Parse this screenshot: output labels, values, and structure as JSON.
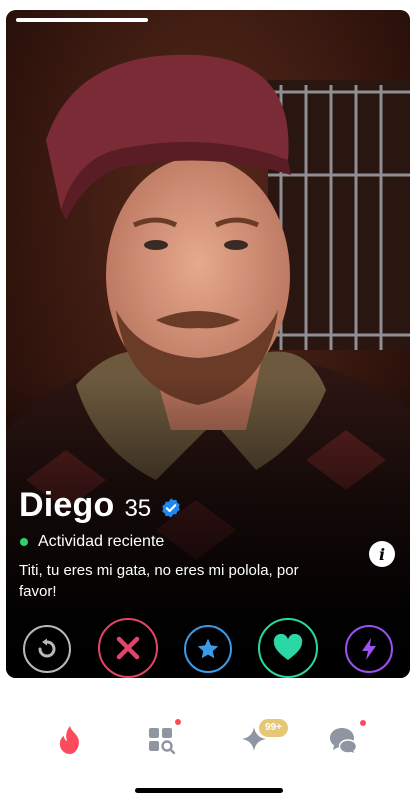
{
  "profile": {
    "name": "Diego",
    "age": "35",
    "verified": true,
    "activity": "Actividad reciente",
    "bio": "Titi, tu eres mi gata, no eres mi polola, por favor!"
  },
  "photo": {
    "index": 1,
    "progress_fraction": 0.33
  },
  "actions": [
    {
      "name": "rewind",
      "icon": "rewind-icon",
      "color": "#b8b9bd"
    },
    {
      "name": "nope",
      "icon": "x-icon",
      "color": "#e2456a"
    },
    {
      "name": "super-like",
      "icon": "star-icon",
      "color": "#3b9be8"
    },
    {
      "name": "like",
      "icon": "heart-icon",
      "color": "#2bd8a5"
    },
    {
      "name": "boost",
      "icon": "lightning-icon",
      "color": "#9b52f0"
    }
  ],
  "tabbar": {
    "items": [
      "flame-icon",
      "explore-icon",
      "sparkle-icon",
      "chat-icon"
    ],
    "sparkle_badge": "99+",
    "accent": "#fd4a5d"
  }
}
